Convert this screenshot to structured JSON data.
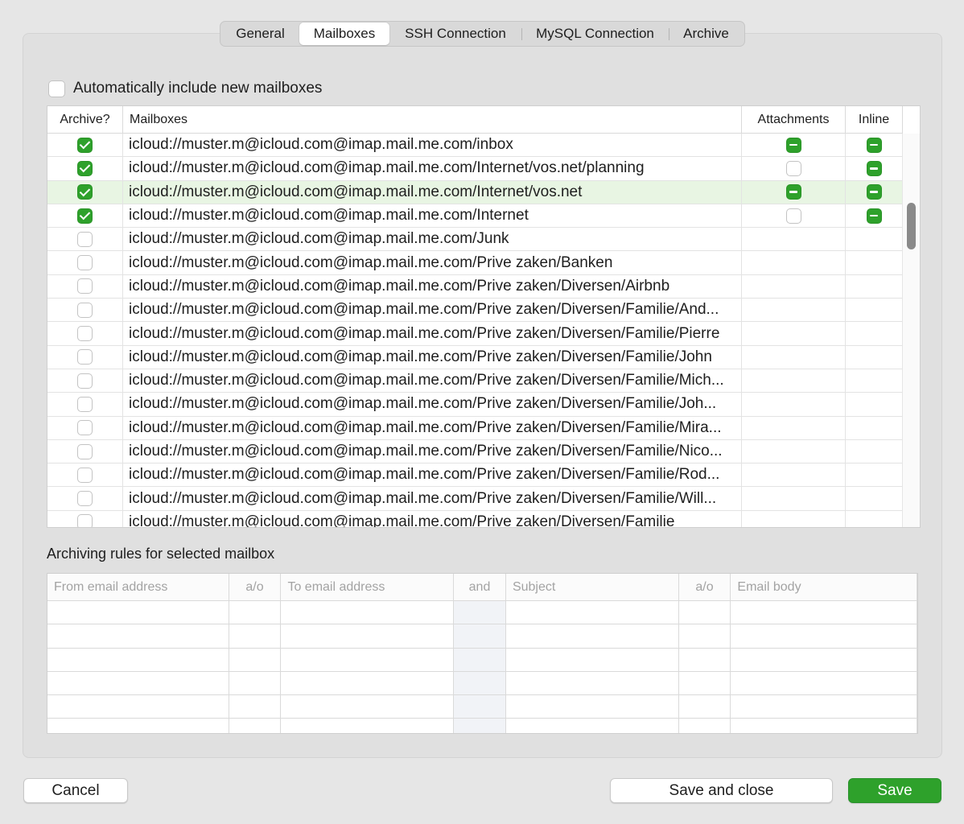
{
  "tabs": [
    {
      "label": "General",
      "active": false
    },
    {
      "label": "Mailboxes",
      "active": true
    },
    {
      "label": "SSH Connection",
      "active": false
    },
    {
      "label": "MySQL Connection",
      "active": false
    },
    {
      "label": "Archive",
      "active": false
    }
  ],
  "auto_include": {
    "label": "Automatically include new mailboxes",
    "checked": false
  },
  "mailbox_table": {
    "headers": {
      "archive": "Archive?",
      "mailboxes": "Mailboxes",
      "attachments": "Attachments",
      "inline": "Inline"
    },
    "rows": [
      {
        "archive": "on",
        "name": "icloud://muster.m@icloud.com@imap.mail.me.com/inbox",
        "attachments": "mixed",
        "inline": "mixed",
        "selected": false
      },
      {
        "archive": "on",
        "name": "icloud://muster.m@icloud.com@imap.mail.me.com/Internet/vos.net/planning",
        "attachments": "off",
        "inline": "mixed",
        "selected": false
      },
      {
        "archive": "on",
        "name": "icloud://muster.m@icloud.com@imap.mail.me.com/Internet/vos.net",
        "attachments": "mixed",
        "inline": "mixed",
        "selected": true
      },
      {
        "archive": "on",
        "name": "icloud://muster.m@icloud.com@imap.mail.me.com/Internet",
        "attachments": "off",
        "inline": "mixed",
        "selected": false
      },
      {
        "archive": "off",
        "name": "icloud://muster.m@icloud.com@imap.mail.me.com/Junk",
        "attachments": "none",
        "inline": "none",
        "selected": false
      },
      {
        "archive": "off",
        "name": "icloud://muster.m@icloud.com@imap.mail.me.com/Prive zaken/Banken",
        "attachments": "none",
        "inline": "none",
        "selected": false
      },
      {
        "archive": "off",
        "name": "icloud://muster.m@icloud.com@imap.mail.me.com/Prive zaken/Diversen/Airbnb",
        "attachments": "none",
        "inline": "none",
        "selected": false
      },
      {
        "archive": "off",
        "name": "icloud://muster.m@icloud.com@imap.mail.me.com/Prive zaken/Diversen/Familie/And...",
        "attachments": "none",
        "inline": "none",
        "selected": false
      },
      {
        "archive": "off",
        "name": "icloud://muster.m@icloud.com@imap.mail.me.com/Prive zaken/Diversen/Familie/Pierre",
        "attachments": "none",
        "inline": "none",
        "selected": false
      },
      {
        "archive": "off",
        "name": "icloud://muster.m@icloud.com@imap.mail.me.com/Prive zaken/Diversen/Familie/John",
        "attachments": "none",
        "inline": "none",
        "selected": false
      },
      {
        "archive": "off",
        "name": "icloud://muster.m@icloud.com@imap.mail.me.com/Prive zaken/Diversen/Familie/Mich...",
        "attachments": "none",
        "inline": "none",
        "selected": false
      },
      {
        "archive": "off",
        "name": "icloud://muster.m@icloud.com@imap.mail.me.com/Prive zaken/Diversen/Familie/Joh...",
        "attachments": "none",
        "inline": "none",
        "selected": false
      },
      {
        "archive": "off",
        "name": "icloud://muster.m@icloud.com@imap.mail.me.com/Prive zaken/Diversen/Familie/Mira...",
        "attachments": "none",
        "inline": "none",
        "selected": false
      },
      {
        "archive": "off",
        "name": "icloud://muster.m@icloud.com@imap.mail.me.com/Prive zaken/Diversen/Familie/Nico...",
        "attachments": "none",
        "inline": "none",
        "selected": false
      },
      {
        "archive": "off",
        "name": "icloud://muster.m@icloud.com@imap.mail.me.com/Prive zaken/Diversen/Familie/Rod...",
        "attachments": "none",
        "inline": "none",
        "selected": false
      },
      {
        "archive": "off",
        "name": "icloud://muster.m@icloud.com@imap.mail.me.com/Prive zaken/Diversen/Familie/Will...",
        "attachments": "none",
        "inline": "none",
        "selected": false
      },
      {
        "archive": "off",
        "name": "icloud://muster.m@icloud.com@imap.mail.me.com/Prive zaken/Diversen/Familie",
        "attachments": "none",
        "inline": "none",
        "selected": false
      }
    ]
  },
  "rules": {
    "title": "Archiving rules for selected mailbox",
    "headers": [
      "From email address",
      "a/o",
      "To email address",
      "and",
      "Subject",
      "a/o",
      "Email body"
    ]
  },
  "buttons": {
    "cancel": "Cancel",
    "save_and_close": "Save and close",
    "save": "Save"
  },
  "colors": {
    "accent": "#2ea12b",
    "selected_row": "#e8f5e3"
  }
}
